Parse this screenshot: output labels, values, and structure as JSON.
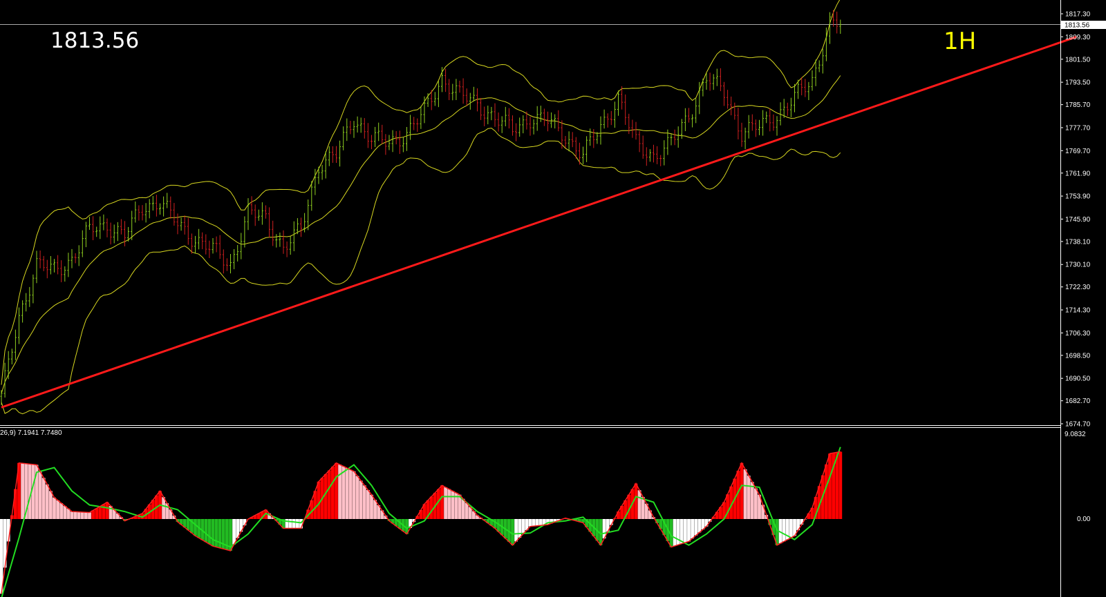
{
  "header": {
    "last_price": "1813.56",
    "timeframe": "1H"
  },
  "macd_panel": {
    "indicator_label": "26,9) 7.1941 7.7480",
    "max_label": "9.0832",
    "zero_label": "0.00"
  },
  "colors": {
    "background": "#000000",
    "axis": "#ffffff",
    "trendline": "#ff1a1a",
    "bollinger": "#d8d820",
    "candle_up": "#90d020",
    "candle_down": "#d02020",
    "hist_pos_strong": "#ff0000",
    "hist_pos_weak": "#ffc0c8",
    "hist_neg_strong": "#22bb22",
    "hist_neg_weak": "#ffffff",
    "macd_line": "#ff2020",
    "signal_line": "#22dd22",
    "price_line": "#aaaaaa",
    "timeframe_text": "#ffff00"
  },
  "chart_data": [
    {
      "type": "line",
      "title": "",
      "last_price_tag": "1813.56",
      "y_ticks": [
        "1817.30",
        "1809.30",
        "1801.50",
        "1793.50",
        "1785.70",
        "1777.70",
        "1769.70",
        "1761.90",
        "1753.90",
        "1745.90",
        "1738.10",
        "1730.10",
        "1722.30",
        "1714.30",
        "1706.30",
        "1698.50",
        "1690.50",
        "1682.70",
        "1674.70"
      ],
      "ylim": [
        1674.7,
        1817.3
      ],
      "series": [
        {
          "x": [
            0,
            5,
            10,
            15,
            20,
            25,
            30,
            35,
            40,
            45,
            50,
            55,
            60,
            65,
            70,
            75,
            80,
            85,
            90,
            95,
            100,
            105,
            110,
            115,
            120,
            125,
            130,
            135,
            140,
            145,
            150,
            155,
            160,
            165,
            170,
            175,
            180,
            185,
            190,
            195,
            200,
            205,
            210,
            215,
            220,
            225,
            230,
            235,
            238
          ],
          "values": [
            1684,
            1712,
            1730,
            1728,
            1732,
            1742,
            1744,
            1740,
            1750,
            1752,
            1744,
            1739,
            1735,
            1730,
            1748,
            1746,
            1736,
            1742,
            1765,
            1768,
            1781,
            1774,
            1772,
            1776,
            1783,
            1795,
            1789,
            1786,
            1781,
            1777,
            1781,
            1780,
            1775,
            1768,
            1778,
            1788,
            1772,
            1768,
            1772,
            1782,
            1795,
            1790,
            1776,
            1778,
            1782,
            1788,
            1794,
            1814,
            1813.56
          ]
        }
      ],
      "trendline": {
        "x": [
          0,
          305
        ],
        "values": [
          1680.4,
          1809.3
        ]
      }
    },
    {
      "type": "line",
      "title": "",
      "ylim": [
        -9,
        9.0832
      ],
      "series": [
        {
          "x": [
            0,
            5,
            10,
            15,
            20,
            25,
            30,
            35,
            40,
            45,
            50,
            55,
            60,
            65,
            70,
            75,
            80,
            85,
            90,
            95,
            100,
            105,
            110,
            115,
            120,
            125,
            130,
            135,
            140,
            145,
            150,
            155,
            160,
            165,
            170,
            175,
            180,
            185,
            190,
            195,
            200,
            205,
            210,
            215,
            220,
            225,
            230,
            235,
            238
          ],
          "values": [
            -8.0,
            6.0,
            5.8,
            2.3,
            0.8,
            0.7,
            1.8,
            -0.2,
            0.6,
            3.0,
            -0.3,
            -1.8,
            -2.9,
            -3.4,
            0.0,
            1.0,
            -1.0,
            -1.0,
            4.0,
            6.0,
            5.1,
            2.6,
            -0.2,
            -1.6,
            1.6,
            3.6,
            2.6,
            0.4,
            -1.0,
            -2.8,
            -0.8,
            -0.6,
            0.1,
            -0.4,
            -2.8,
            0.8,
            3.8,
            0.2,
            -3.0,
            -2.4,
            -0.8,
            1.8,
            6.0,
            2.6,
            -2.8,
            -1.8,
            1.2,
            7.0,
            7.2
          ]
        },
        {
          "x": [
            0,
            5,
            10,
            15,
            20,
            25,
            30,
            35,
            40,
            45,
            50,
            55,
            60,
            65,
            70,
            75,
            80,
            85,
            90,
            95,
            100,
            105,
            110,
            115,
            120,
            125,
            130,
            135,
            140,
            145,
            150,
            155,
            160,
            165,
            170,
            175,
            180,
            185,
            190,
            195,
            200,
            205,
            210,
            215,
            220,
            225,
            230,
            235,
            238
          ],
          "values": [
            -8.5,
            -2.0,
            5.0,
            5.5,
            3.0,
            1.5,
            1.2,
            0.8,
            0.2,
            1.5,
            1.0,
            -0.6,
            -2.2,
            -3.0,
            -1.6,
            0.6,
            -0.2,
            -0.4,
            1.6,
            4.5,
            5.8,
            3.6,
            0.6,
            -1.0,
            -0.2,
            2.4,
            2.4,
            0.8,
            -0.3,
            -1.6,
            -1.5,
            -0.4,
            -0.2,
            0.2,
            -1.6,
            -1.2,
            2.4,
            1.8,
            -1.8,
            -2.8,
            -1.6,
            0.0,
            3.6,
            3.4,
            -1.2,
            -2.2,
            -0.6,
            4.5,
            7.7
          ]
        }
      ]
    }
  ]
}
